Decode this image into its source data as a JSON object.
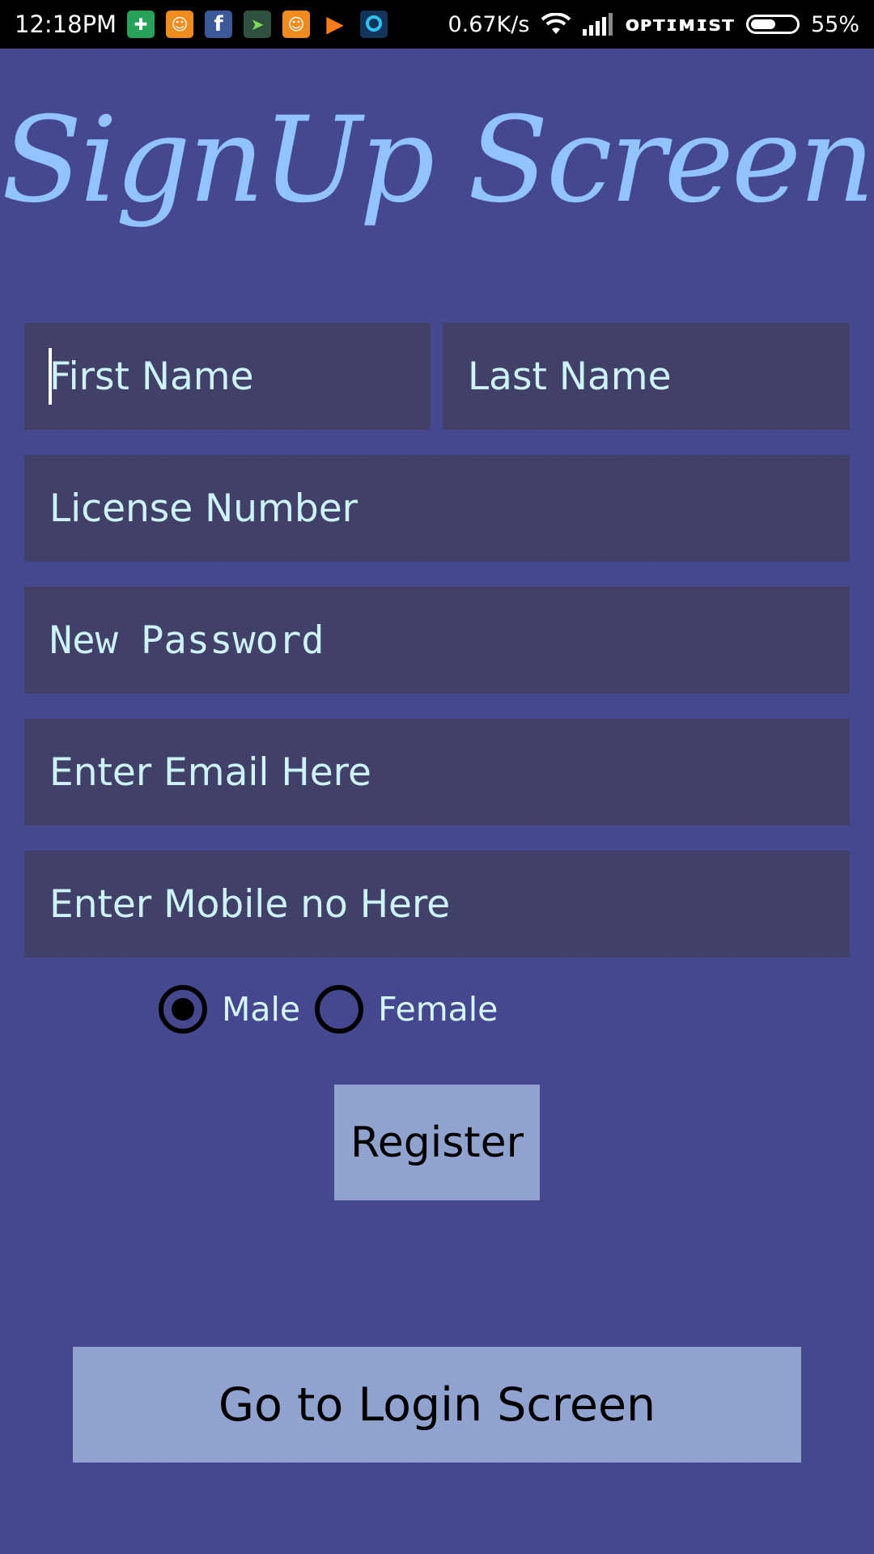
{
  "status_bar": {
    "time": "12:18PM",
    "network_speed": "0.67K/s",
    "carrier": "ᴏᴘᴛɪᴍɪѕᴛ",
    "battery_level": "55%",
    "battery_fraction": 0.55,
    "notification_icons": [
      "shield-icon",
      "uc-browser-icon",
      "facebook-icon",
      "messenger-plane-icon",
      "uc-browser-icon",
      "play-music-icon",
      "circle-app-icon"
    ]
  },
  "title": "SignUp Screen",
  "form": {
    "first_name_placeholder": "First Name",
    "last_name_placeholder": "Last Name",
    "license_placeholder": "License Number",
    "password_placeholder": "New Password",
    "email_placeholder": "Enter Email Here",
    "mobile_placeholder": "Enter Mobile no Here"
  },
  "gender": {
    "options": [
      {
        "label": "Male",
        "checked": true
      },
      {
        "label": "Female",
        "checked": false
      }
    ]
  },
  "buttons": {
    "register": "Register",
    "go_to_login": "Go to Login Screen"
  },
  "colors": {
    "background": "#45488e",
    "input_background": "#414068",
    "title": "#90c3ff",
    "button": "#90a3cf",
    "input_text": "#cdf3ff"
  }
}
